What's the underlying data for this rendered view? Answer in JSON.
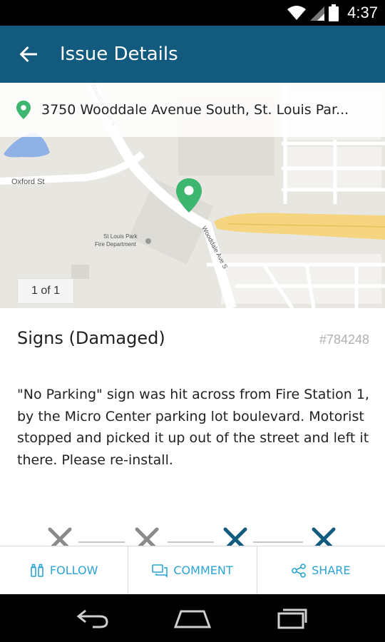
{
  "status_bar": {
    "time": "4:37",
    "icons": [
      "wifi-icon",
      "signal-icon",
      "battery-icon"
    ]
  },
  "app_bar": {
    "title": "Issue Details",
    "back_icon": "arrow-back-icon"
  },
  "map": {
    "address": "3750 Wooddale Avenue South, St. Louis Par...",
    "page_indicator": "1 of 1",
    "street_labels": [
      "Oxford St",
      "Wooddale Ave S",
      "St Louis Park Fire Department",
      "Wooddale Ave S"
    ],
    "pin_color": "#3db66f"
  },
  "issue": {
    "title": "Signs (Damaged)",
    "id": "#784248",
    "description": "\"No Parking\" sign was hit across from Fire Station 1, by the Micro Center parking lot boulevard. Motorist stopped and picked it up out of the street and left it there. Please re-install."
  },
  "actions": [
    {
      "label": "FOLLOW",
      "icon": "binoculars-icon"
    },
    {
      "label": "COMMENT",
      "icon": "comment-icon"
    },
    {
      "label": "SHARE",
      "icon": "share-icon"
    }
  ],
  "colors": {
    "app_bar": "#135b7e",
    "accent": "#2aa3d6"
  }
}
